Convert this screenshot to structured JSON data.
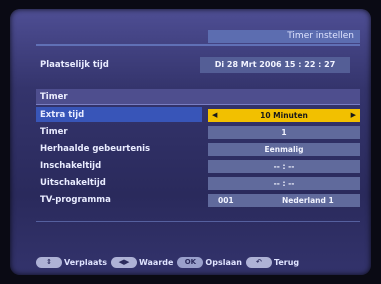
{
  "header": {
    "title": "Timer instellen"
  },
  "local_time": {
    "label": "Plaatselijk tijd",
    "value": "Di 28 Mrt 2006 15 : 22 : 27"
  },
  "section": {
    "title": "Timer"
  },
  "rows": [
    {
      "label": "Extra tijd",
      "value": "10 Minuten",
      "selected": true
    },
    {
      "label": "Timer",
      "value": "1"
    },
    {
      "label": "Herhaalde gebeurtenis",
      "value": "Eenmalig"
    },
    {
      "label": "Inschakeltijd",
      "value": "-- : --"
    },
    {
      "label": "Uitschakeltijd",
      "value": "-- : --"
    },
    {
      "label": "TV-programma",
      "channel_number": "001",
      "channel_name": "Nederland 1"
    }
  ],
  "footer": {
    "items": [
      {
        "icon": "up-down-arrows-icon",
        "label": "Verplaats"
      },
      {
        "icon": "left-right-arrows-icon",
        "label": "Waarde"
      },
      {
        "icon": "ok-button-icon",
        "key": "OK",
        "label": "Opslaan"
      },
      {
        "icon": "back-arrow-icon",
        "label": "Terug"
      }
    ]
  },
  "colors": {
    "selected_value": "#f2c000",
    "highlight_row": "#3855b8",
    "value_box": "#606a9c"
  }
}
